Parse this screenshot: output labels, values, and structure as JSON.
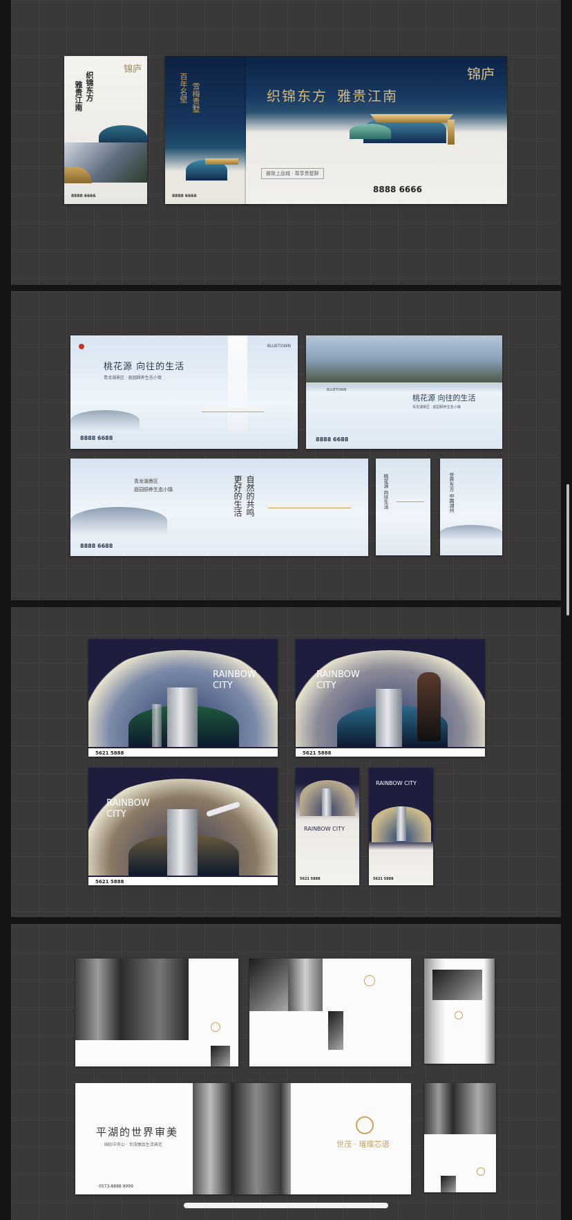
{
  "panel1": {
    "card_a": {
      "brand": "锦庐",
      "vertical_1": "织锦东方",
      "vertical_2": "雅贵江南",
      "phone": "8888 6666"
    },
    "card_b": {
      "vertical_1": "百年名壁",
      "vertical_2": "雪梅贵墅",
      "phone": "8888 6666"
    },
    "card_c": {
      "brand": "锦庐",
      "headline_1": "织锦东方",
      "headline_2": "雅贵江南",
      "tagline": "雅致上品城 · 尊享贵墅群",
      "phone": "8888 6666"
    }
  },
  "panel2": {
    "card_a": {
      "headline": "桃花源 向往的生活",
      "sub": "青龙湖景区 · 庭园颐养生态小镇",
      "phone": "8888 6688",
      "brand": "BLUETOWN"
    },
    "card_b": {
      "headline": "桃花源 向往的生活",
      "sub": "青龙湖景区 · 庭园颐养生态小镇",
      "phone": "8888 6688",
      "brand": "BLUETOWN"
    },
    "card_c": {
      "sub_1": "青龙湖景区",
      "sub_2": "庭园颐养生态小镇",
      "vertical_1": "更好的生活",
      "vertical_2": "自然的共鸣",
      "phone": "8888 6688"
    },
    "card_d": {
      "vertical": "桃花源 向往生活"
    },
    "card_e": {
      "vertical": "世界东方 中国湖州"
    }
  },
  "panel3": {
    "card_a": {
      "title_1": "RAINBOW",
      "title_2": "CITY",
      "phone": "5621 5888"
    },
    "card_b": {
      "title_1": "RAINBOW",
      "title_2": "CITY",
      "phone": "5621 5888"
    },
    "card_c": {
      "title_1": "RAINBOW",
      "title_2": "CITY",
      "phone": "5621 5888"
    },
    "card_d": {
      "title": "RAINBOW CITY",
      "phone": "5621 5888"
    },
    "card_e": {
      "title": "RAINBOW CITY",
      "phone": "5621 5888"
    }
  },
  "panel4": {
    "card_f": {
      "headline": "平湖的世界审美",
      "sub": "国际中央公 · 世茂臻品生活典范",
      "brand": "世茂 · 璀璨芯语",
      "phone": "0573-8888 9999"
    }
  },
  "colors": {
    "panel_bg": "#3a3838",
    "outer_bg": "#151515",
    "navy": "#0f2647",
    "gold": "#c9a35a",
    "rainbow_bg": "#1e1d3e"
  }
}
